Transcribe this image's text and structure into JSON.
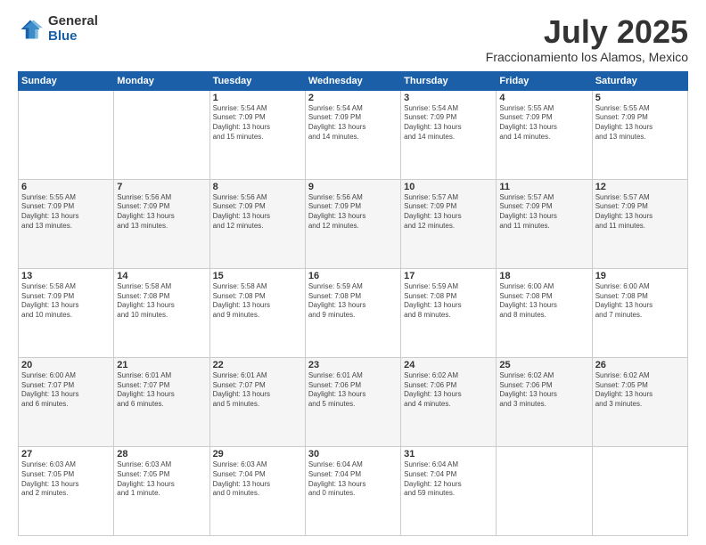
{
  "logo": {
    "general": "General",
    "blue": "Blue"
  },
  "header": {
    "month": "July 2025",
    "location": "Fraccionamiento los Alamos, Mexico"
  },
  "weekdays": [
    "Sunday",
    "Monday",
    "Tuesday",
    "Wednesday",
    "Thursday",
    "Friday",
    "Saturday"
  ],
  "weeks": [
    [
      {
        "day": "",
        "info": ""
      },
      {
        "day": "",
        "info": ""
      },
      {
        "day": "1",
        "info": "Sunrise: 5:54 AM\nSunset: 7:09 PM\nDaylight: 13 hours\nand 15 minutes."
      },
      {
        "day": "2",
        "info": "Sunrise: 5:54 AM\nSunset: 7:09 PM\nDaylight: 13 hours\nand 14 minutes."
      },
      {
        "day": "3",
        "info": "Sunrise: 5:54 AM\nSunset: 7:09 PM\nDaylight: 13 hours\nand 14 minutes."
      },
      {
        "day": "4",
        "info": "Sunrise: 5:55 AM\nSunset: 7:09 PM\nDaylight: 13 hours\nand 14 minutes."
      },
      {
        "day": "5",
        "info": "Sunrise: 5:55 AM\nSunset: 7:09 PM\nDaylight: 13 hours\nand 13 minutes."
      }
    ],
    [
      {
        "day": "6",
        "info": "Sunrise: 5:55 AM\nSunset: 7:09 PM\nDaylight: 13 hours\nand 13 minutes."
      },
      {
        "day": "7",
        "info": "Sunrise: 5:56 AM\nSunset: 7:09 PM\nDaylight: 13 hours\nand 13 minutes."
      },
      {
        "day": "8",
        "info": "Sunrise: 5:56 AM\nSunset: 7:09 PM\nDaylight: 13 hours\nand 12 minutes."
      },
      {
        "day": "9",
        "info": "Sunrise: 5:56 AM\nSunset: 7:09 PM\nDaylight: 13 hours\nand 12 minutes."
      },
      {
        "day": "10",
        "info": "Sunrise: 5:57 AM\nSunset: 7:09 PM\nDaylight: 13 hours\nand 12 minutes."
      },
      {
        "day": "11",
        "info": "Sunrise: 5:57 AM\nSunset: 7:09 PM\nDaylight: 13 hours\nand 11 minutes."
      },
      {
        "day": "12",
        "info": "Sunrise: 5:57 AM\nSunset: 7:09 PM\nDaylight: 13 hours\nand 11 minutes."
      }
    ],
    [
      {
        "day": "13",
        "info": "Sunrise: 5:58 AM\nSunset: 7:09 PM\nDaylight: 13 hours\nand 10 minutes."
      },
      {
        "day": "14",
        "info": "Sunrise: 5:58 AM\nSunset: 7:08 PM\nDaylight: 13 hours\nand 10 minutes."
      },
      {
        "day": "15",
        "info": "Sunrise: 5:58 AM\nSunset: 7:08 PM\nDaylight: 13 hours\nand 9 minutes."
      },
      {
        "day": "16",
        "info": "Sunrise: 5:59 AM\nSunset: 7:08 PM\nDaylight: 13 hours\nand 9 minutes."
      },
      {
        "day": "17",
        "info": "Sunrise: 5:59 AM\nSunset: 7:08 PM\nDaylight: 13 hours\nand 8 minutes."
      },
      {
        "day": "18",
        "info": "Sunrise: 6:00 AM\nSunset: 7:08 PM\nDaylight: 13 hours\nand 8 minutes."
      },
      {
        "day": "19",
        "info": "Sunrise: 6:00 AM\nSunset: 7:08 PM\nDaylight: 13 hours\nand 7 minutes."
      }
    ],
    [
      {
        "day": "20",
        "info": "Sunrise: 6:00 AM\nSunset: 7:07 PM\nDaylight: 13 hours\nand 6 minutes."
      },
      {
        "day": "21",
        "info": "Sunrise: 6:01 AM\nSunset: 7:07 PM\nDaylight: 13 hours\nand 6 minutes."
      },
      {
        "day": "22",
        "info": "Sunrise: 6:01 AM\nSunset: 7:07 PM\nDaylight: 13 hours\nand 5 minutes."
      },
      {
        "day": "23",
        "info": "Sunrise: 6:01 AM\nSunset: 7:06 PM\nDaylight: 13 hours\nand 5 minutes."
      },
      {
        "day": "24",
        "info": "Sunrise: 6:02 AM\nSunset: 7:06 PM\nDaylight: 13 hours\nand 4 minutes."
      },
      {
        "day": "25",
        "info": "Sunrise: 6:02 AM\nSunset: 7:06 PM\nDaylight: 13 hours\nand 3 minutes."
      },
      {
        "day": "26",
        "info": "Sunrise: 6:02 AM\nSunset: 7:05 PM\nDaylight: 13 hours\nand 3 minutes."
      }
    ],
    [
      {
        "day": "27",
        "info": "Sunrise: 6:03 AM\nSunset: 7:05 PM\nDaylight: 13 hours\nand 2 minutes."
      },
      {
        "day": "28",
        "info": "Sunrise: 6:03 AM\nSunset: 7:05 PM\nDaylight: 13 hours\nand 1 minute."
      },
      {
        "day": "29",
        "info": "Sunrise: 6:03 AM\nSunset: 7:04 PM\nDaylight: 13 hours\nand 0 minutes."
      },
      {
        "day": "30",
        "info": "Sunrise: 6:04 AM\nSunset: 7:04 PM\nDaylight: 13 hours\nand 0 minutes."
      },
      {
        "day": "31",
        "info": "Sunrise: 6:04 AM\nSunset: 7:04 PM\nDaylight: 12 hours\nand 59 minutes."
      },
      {
        "day": "",
        "info": ""
      },
      {
        "day": "",
        "info": ""
      }
    ]
  ]
}
